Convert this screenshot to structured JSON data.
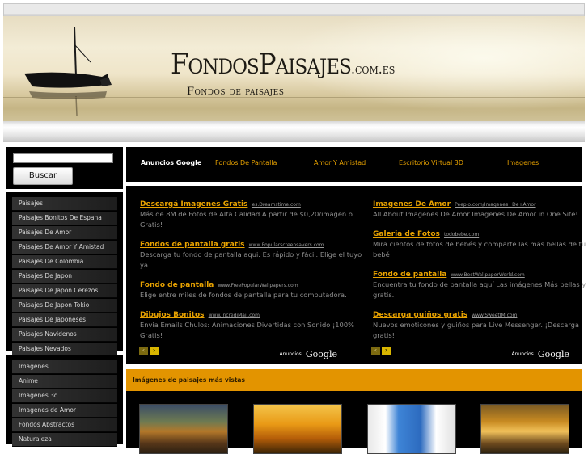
{
  "header": {
    "logo_main": "FondosPaisajes",
    "logo_ext": ".com.es",
    "logo_sub": "Fondos de paisajes"
  },
  "search": {
    "input_value": "",
    "button_label": "Buscar"
  },
  "sidebar": {
    "menu1": [
      "Paisajes",
      "Paisajes Bonitos De Espana",
      "Paisajes De Amor",
      "Paisajes De Amor Y Amistad",
      "Paisajes De Colombia",
      "Paisajes De Japon",
      "Paisajes De Japon Cerezos",
      "Paisajes De Japon Tokio",
      "Paisajes De Japoneses",
      "Paisajes Navidenos",
      "Paisajes Nevados"
    ],
    "menu2": [
      "Imagenes",
      "Anime",
      "Imagenes 3d",
      "Imagenes de Amor",
      "Fondos Abstractos",
      "Naturaleza"
    ]
  },
  "nav": {
    "google_label": "Anuncios Google",
    "links": [
      "Fondos De Pantalla",
      "Amor Y Amistad",
      "Escritorio Virtual 3D",
      "Imagenes"
    ]
  },
  "ads": {
    "col1": [
      {
        "title": "Descargá Imagenes Gratis",
        "url": "es.Dreamstime.com",
        "desc": "Más de 8M de Fotos de Alta Calidad A partir de $0,20/imagen o Gratis!"
      },
      {
        "title": "Fondos de pantalla gratis",
        "url": "www.Popularscreensavers.com",
        "desc": "Descarga tu fondo de pantalla aqui. Es rápido y fácil. Elige el tuyo ya"
      },
      {
        "title": "Fondo de pantalla",
        "url": "www.FreePopularWallpapers.com",
        "desc": "Elige entre miles de fondos de pantalla para tu computadora."
      },
      {
        "title": "Dibujos Bonitos",
        "url": "www.IncrediMail.com",
        "desc": "Envia Emails Chulos: Animaciones Divertidas con Sonido ¡100% Gratis!"
      }
    ],
    "col2": [
      {
        "title": "Imagenes De Amor",
        "url": "Peeplo.com/Imagenes+De+Amor",
        "desc": "All About Imagenes De Amor Imagenes De Amor in One Site!"
      },
      {
        "title": "Galeria de Fotos",
        "url": "todobebe.com",
        "desc": "Mira cientos de fotos de bebés y comparte las más bellas de tu bebé"
      },
      {
        "title": "Fondo de pantalla",
        "url": "www.BestWallpaperWorld.com",
        "desc": "Encuentra tu fondo de pantalla aquí Las imágenes Más bellas y gratis."
      },
      {
        "title": "Descarga guiños gratis",
        "url": "www.SweetIM.com",
        "desc": "Nuevos emoticones y guiños para Live Messenger. ¡Descarga gratis!"
      }
    ],
    "brand_small": "Anuncios",
    "brand_big": "Google",
    "arrow_left": "‹",
    "arrow_right": "›"
  },
  "most_viewed": {
    "title": "Imágenes de paisajes más vistas"
  }
}
